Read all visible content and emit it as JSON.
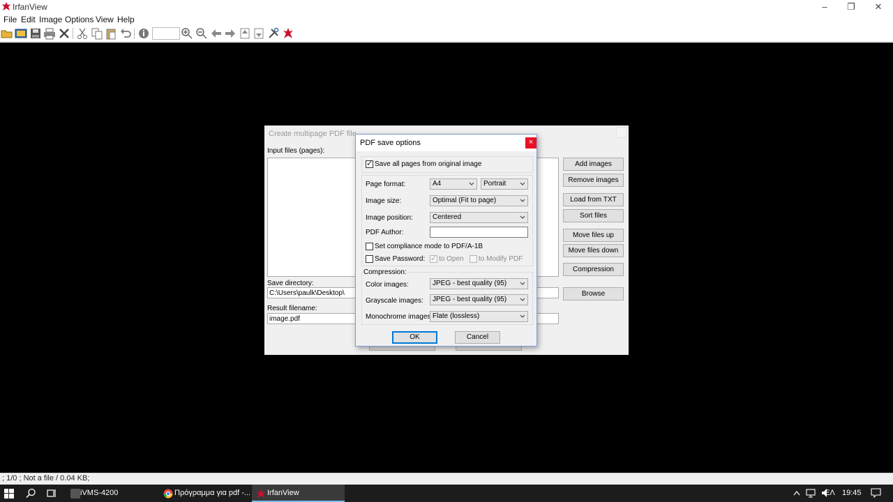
{
  "app": {
    "title": "IrfanView",
    "brand_color": "#c8102e"
  },
  "menu": {
    "items": [
      "File",
      "Edit",
      "Image",
      "Options",
      "View",
      "Help"
    ]
  },
  "toolbar": {
    "icons": [
      "open-folder-icon",
      "slideshow-icon",
      "save-icon",
      "print-icon",
      "delete-icon",
      "cut-icon",
      "copy-icon",
      "paste-icon",
      "undo-icon",
      "info-icon",
      "zoom-in-icon",
      "zoom-out-icon",
      "previous-icon",
      "next-icon",
      "first-icon",
      "last-icon",
      "settings-icon",
      "irfanview-logo-icon"
    ]
  },
  "status": {
    "text": "; 1/0 ; Not a file / 0.04 KB;"
  },
  "taskbar": {
    "items": [
      {
        "label": "iVMS-4200"
      },
      {
        "label": "Πρόγραμμα για pdf -..."
      },
      {
        "label": "IrfanView"
      }
    ],
    "language": "ΕΛ",
    "time": "19:45"
  },
  "bg_dialog": {
    "title": "Create multipage PDF file",
    "input_files_label": "Input files (pages):",
    "buttons": [
      "Add images",
      "Remove images",
      "Load from TXT",
      "Sort files",
      "Move files up",
      "Move files down",
      "Compression"
    ],
    "save_directory_label": "Save directory:",
    "save_directory_value": "C:\\Users\\paulk\\Desktop\\",
    "browse_label": "Browse",
    "result_filename_label": "Result filename:",
    "result_filename_value": "image.pdf"
  },
  "dialog": {
    "title": "PDF save options",
    "close_symbol": "×",
    "save_all_pages": {
      "label": "Save all pages from original image",
      "checked": true
    },
    "page_format": {
      "label": "Page format:",
      "value": "A4",
      "orientation": "Portrait"
    },
    "image_size": {
      "label": "Image size:",
      "value": "Optimal (Fit to page)"
    },
    "image_position": {
      "label": "Image position:",
      "value": "Centered"
    },
    "pdf_author": {
      "label": "PDF Author:",
      "value": ""
    },
    "compliance": {
      "label": "Set compliance mode to PDF/A-1B",
      "checked": false
    },
    "save_password": {
      "label": "Save Password:",
      "checked": false
    },
    "to_open": {
      "label": "to Open",
      "checked": true,
      "enabled": false
    },
    "to_modify": {
      "label": "to Modify  PDF",
      "checked": false,
      "enabled": false
    },
    "compression": {
      "label": "Compression:",
      "color_images": {
        "label": "Color images:",
        "value": "JPEG - best quality (95)"
      },
      "grayscale_images": {
        "label": "Grayscale images:",
        "value": "JPEG - best quality (95)"
      },
      "monochrome_images": {
        "label": "Monochrome images:",
        "value": "Flate (lossless)"
      }
    },
    "ok_label": "OK",
    "cancel_label": "Cancel"
  }
}
